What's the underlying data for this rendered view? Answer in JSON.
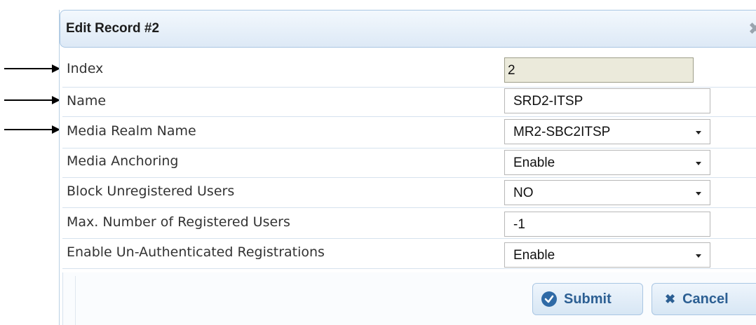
{
  "dialog": {
    "title": "Edit Record #2",
    "close_glyph": "✖"
  },
  "fields": [
    {
      "label": "Index",
      "value": "2",
      "type": "readonly"
    },
    {
      "label": "Name",
      "value": "SRD2-ITSP",
      "type": "text"
    },
    {
      "label": "Media Realm Name",
      "value": "MR2-SBC2ITSP",
      "type": "select"
    },
    {
      "label": "Media Anchoring",
      "value": "Enable",
      "type": "select"
    },
    {
      "label": "Block Unregistered Users",
      "value": "NO",
      "type": "select"
    },
    {
      "label": "Max. Number of Registered Users",
      "value": "-1",
      "type": "text"
    },
    {
      "label": "Enable Un-Authenticated Registrations",
      "value": "Enable",
      "type": "select"
    }
  ],
  "buttons": {
    "submit": "Submit",
    "cancel": "Cancel",
    "cancel_glyph": "✖"
  },
  "annotations": {
    "arrows": [
      "arrow-to-index",
      "arrow-to-name",
      "arrow-to-media-realm-name"
    ]
  }
}
